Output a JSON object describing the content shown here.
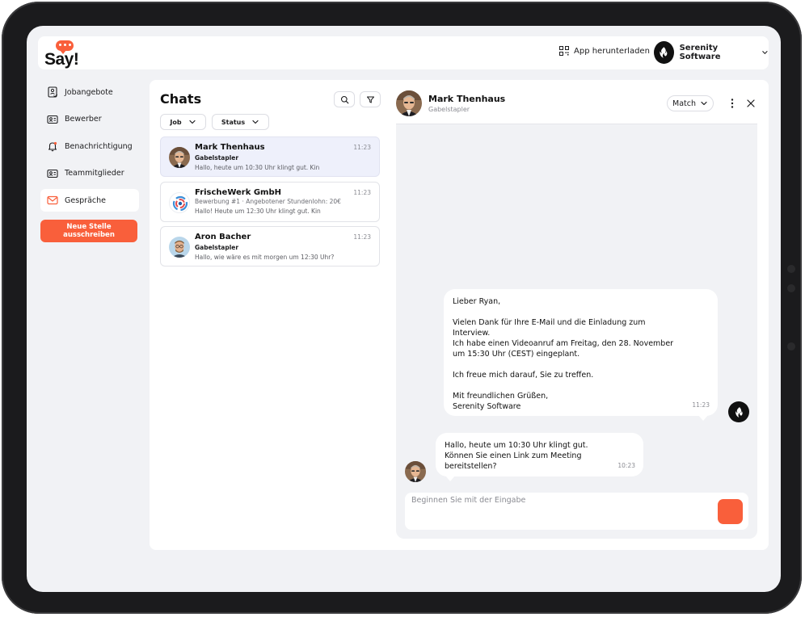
{
  "header": {
    "logo_text": "Say!",
    "app_download_label": "App herunterladen",
    "company_name": "Serenity Software"
  },
  "sidebar": {
    "items": [
      {
        "label": "Jobangebote",
        "icon": "job-list-icon",
        "active": false
      },
      {
        "label": "Bewerber",
        "icon": "applicant-card-icon",
        "active": false
      },
      {
        "label": "Benachrichtigung",
        "icon": "bell-icon",
        "active": false
      },
      {
        "label": "Teammitglieder",
        "icon": "team-card-icon",
        "active": false
      },
      {
        "label": "Gespräche",
        "icon": "mail-icon",
        "active": true
      }
    ],
    "cta_line1": "Neue Stelle",
    "cta_line2": "ausschreiben"
  },
  "chats": {
    "title": "Chats",
    "filters": {
      "job": "Job",
      "status": "Status"
    },
    "items": [
      {
        "name": "Mark Thenhaus",
        "subtitle": "Gabelstapler",
        "time": "11:23",
        "message": "Hallo, heute um 10:30 Uhr klingt gut. Kin",
        "selected": true
      },
      {
        "name": "FrischeWerk GmbH",
        "subtitle": "Bewerbung #1   ·   Angebotener Stundenlohn: 20€",
        "time": "11:23",
        "message": "Hallo! Heute um 12:30 Uhr klingt gut. Kin",
        "selected": false
      },
      {
        "name": "Aron Bacher",
        "subtitle": "Gabelstapler",
        "time": "11:23",
        "message": "Hallo, wie wäre es mit morgen um 12:30 Uhr?",
        "selected": false
      }
    ]
  },
  "conversation": {
    "name": "Mark Thenhaus",
    "role": "Gabelstapler",
    "match_label": "Match",
    "messages": [
      {
        "direction": "outgoing",
        "lines": [
          "Lieber Ryan,",
          "",
          "Vielen Dank für Ihre E-Mail und die Einladung zum",
          "Interview.",
          "Ich habe einen Videoanruf am Freitag, den 28. November",
          "um 15:30 Uhr (CEST) eingeplant.",
          "",
          "Ich freue mich darauf, Sie zu treffen.",
          "",
          "Mit freundlichen Grüßen,",
          "Serenity Software"
        ],
        "time": "11:23"
      },
      {
        "direction": "incoming",
        "lines": [
          "Hallo, heute um 10:30 Uhr klingt gut.",
          "Können Sie einen Link zum Meeting",
          "bereitstellen?"
        ],
        "time": "10:23"
      }
    ],
    "input_placeholder": "Beginnen Sie mit der Eingabe",
    "input_value": ""
  },
  "colors": {
    "accent": "#f95f3b",
    "selected_chat_bg": "#eef0fb",
    "screen_bg": "#f1f2f5"
  }
}
